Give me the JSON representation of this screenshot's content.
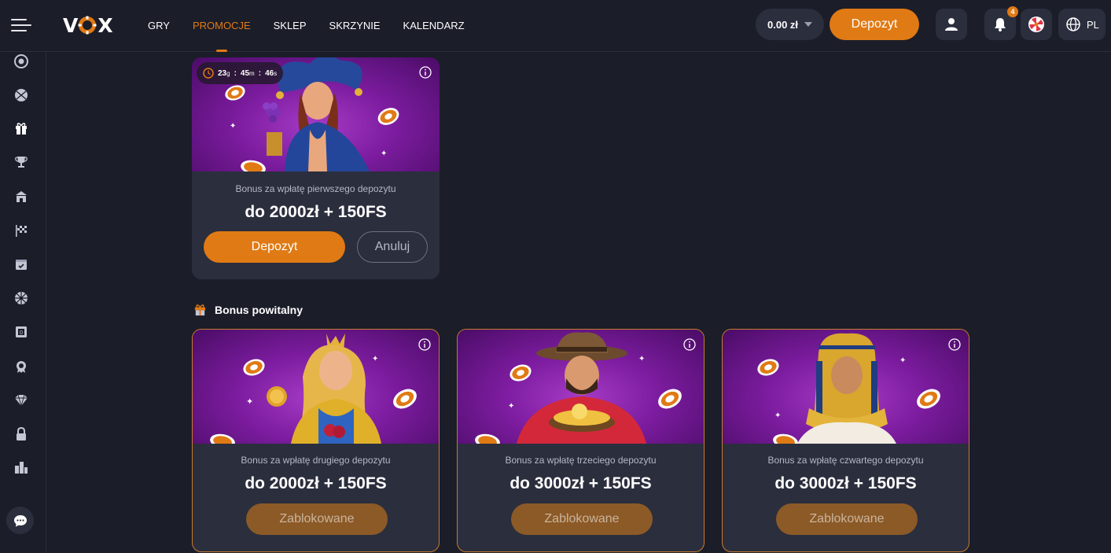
{
  "header": {
    "logo": "VOX",
    "nav": [
      "GRY",
      "PROMOCJE",
      "SKLEP",
      "SKRZYNIE",
      "KALENDARZ"
    ],
    "balance": "0.00 zł",
    "deposit_label": "Depozyt",
    "notifications_count": "4",
    "language": "PL"
  },
  "sidebar": {
    "icons": [
      "casino-chip-icon",
      "basketball-icon",
      "gift-icon",
      "trophy-icon",
      "shop-icon",
      "race-flag-icon",
      "calendar-icon",
      "wheel-icon",
      "ticket-icon",
      "award-icon",
      "diamond-icon",
      "lock-icon",
      "leaderboard-icon"
    ],
    "chat_icon": "chat-icon"
  },
  "active_card": {
    "timer": {
      "days": "23",
      "days_unit": "g",
      "hours": "45",
      "hours_unit": "m",
      "sep": ":",
      "seconds": "46",
      "seconds_unit": "s"
    },
    "subtitle": "Bonus za wpłatę pierwszego depozytu",
    "amount": "do 2000zł + 150FS",
    "deposit_label": "Depozyt",
    "cancel_label": "Anuluj"
  },
  "section": {
    "title": "Bonus powitalny"
  },
  "locked_cards": [
    {
      "subtitle": "Bonus za wpłatę drugiego depozytu",
      "amount": "do 2000zł + 150FS",
      "button": "Zablokowane"
    },
    {
      "subtitle": "Bonus za wpłatę trzeciego depozytu",
      "amount": "do 3000zł + 150FS",
      "button": "Zablokowane"
    },
    {
      "subtitle": "Bonus za wpłatę czwartego depozytu",
      "amount": "do 3000zł + 150FS",
      "button": "Zablokowane"
    }
  ],
  "colors": {
    "accent": "#e07a14",
    "background": "#1b1d29",
    "card": "#2b2e3d",
    "locked_button": "#8c5a27"
  }
}
